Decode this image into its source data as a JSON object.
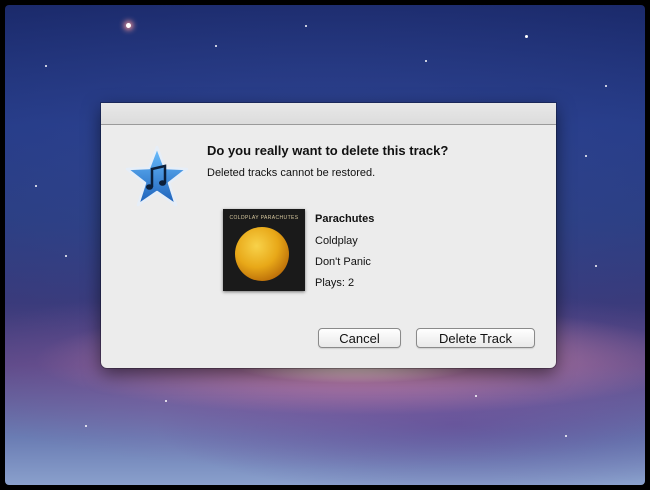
{
  "dialog": {
    "title": "Do you really want to delete this track?",
    "message": "Deleted tracks cannot be restored.",
    "icon": "music-star-icon",
    "track": {
      "name": "Parachutes",
      "artist": "Coldplay",
      "song": "Don't Panic",
      "plays": "Plays: 2",
      "artwork_label": "COLDPLAY PARACHUTES"
    },
    "buttons": {
      "cancel": "Cancel",
      "delete": "Delete Track"
    }
  },
  "colors": {
    "icon_blue": "#2c7fd6",
    "dialog_bg": "#ececec",
    "artwork_gold": "#e8a818"
  }
}
